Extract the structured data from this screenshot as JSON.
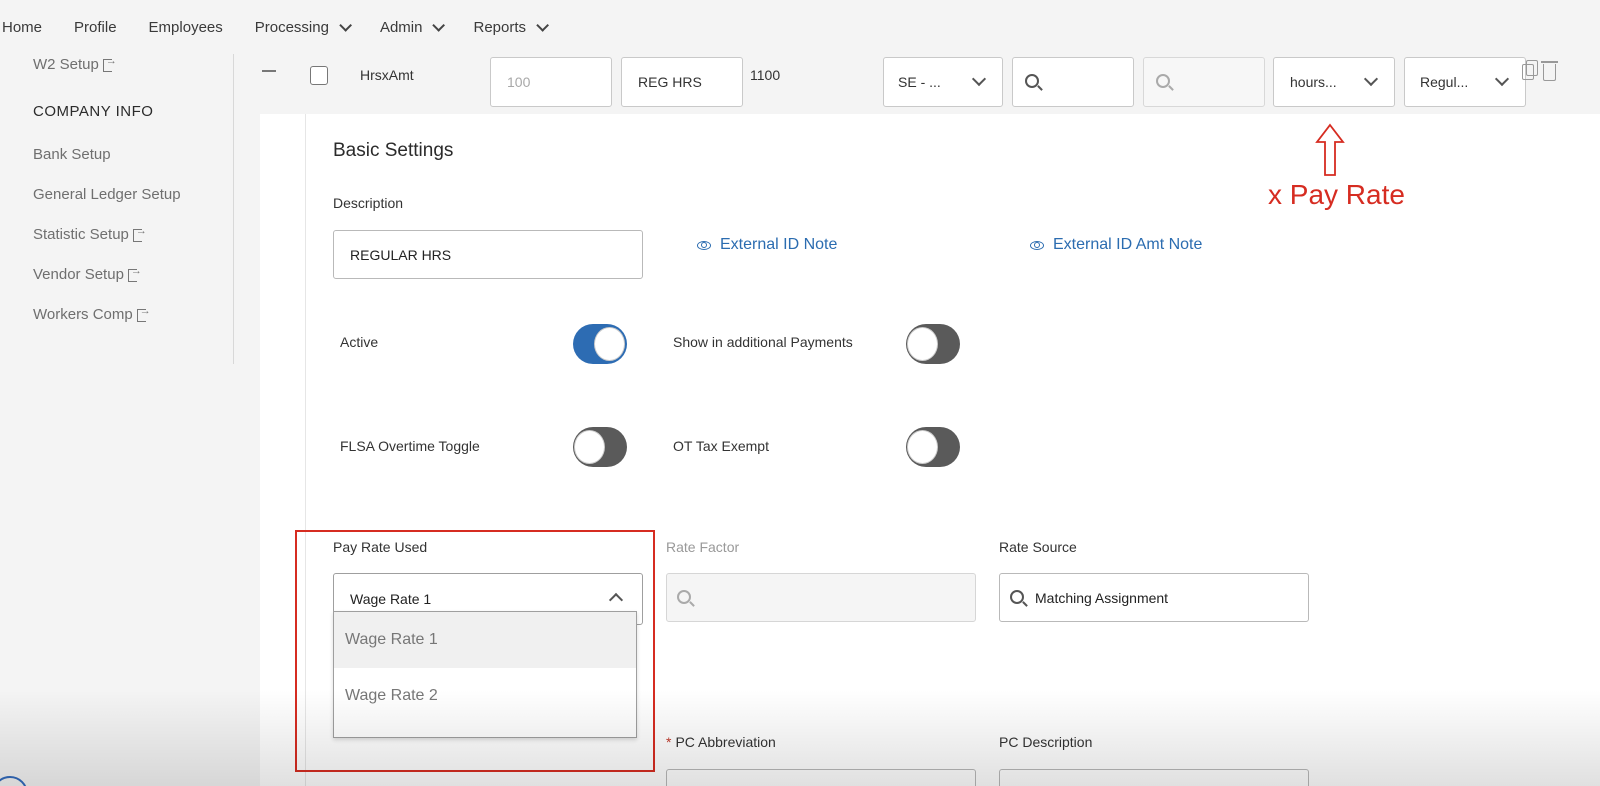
{
  "nav": {
    "items": [
      {
        "label": "Home",
        "dropdown": false
      },
      {
        "label": "Profile",
        "dropdown": false
      },
      {
        "label": "Employees",
        "dropdown": false
      },
      {
        "label": "Processing",
        "dropdown": true
      },
      {
        "label": "Admin",
        "dropdown": true
      },
      {
        "label": "Reports",
        "dropdown": true
      }
    ]
  },
  "sidebar": {
    "w2_setup": "W2 Setup",
    "section_title": "COMPANY INFO",
    "items": [
      {
        "label": "Bank Setup",
        "external": false
      },
      {
        "label": "General Ledger Setup",
        "external": false
      },
      {
        "label": "Statistic Setup",
        "external": true
      },
      {
        "label": "Vendor Setup",
        "external": true
      },
      {
        "label": "Workers Comp",
        "external": true
      }
    ]
  },
  "code_row": {
    "code": "HrsxAmt",
    "amount_placeholder": "100",
    "abbreviation": "REG HRS",
    "number": "1100",
    "select_1": "SE - ...",
    "select_hours": "hours...",
    "select_regular": "Regul..."
  },
  "basic_settings": {
    "title": "Basic Settings",
    "description_label": "Description",
    "description_value": "REGULAR HRS",
    "external_id_note": "External ID Note",
    "external_id_amt_note": "External ID Amt Note",
    "toggles": {
      "active": {
        "label": "Active",
        "on": true
      },
      "show_additional": {
        "label": "Show in additional Payments",
        "on": false
      },
      "flsa": {
        "label": "FLSA Overtime Toggle",
        "on": false
      },
      "ot_tax_exempt": {
        "label": "OT Tax Exempt",
        "on": false
      }
    },
    "pay_rate_used_label": "Pay Rate Used",
    "pay_rate_used_value": "Wage Rate 1",
    "pay_rate_options": [
      "Wage Rate 1",
      "Wage Rate 2"
    ],
    "rate_factor_label": "Rate Factor",
    "rate_source_label": "Rate Source",
    "rate_source_value": "Matching Assignment",
    "pc_abbreviation_label": "PC Abbreviation",
    "pc_description_label": "PC Description"
  },
  "annotation": {
    "text": "x Pay Rate",
    "color": "#d62c21"
  },
  "colors": {
    "accent_blue": "#2d6cb3",
    "link_blue": "#2b6cb0",
    "annotation_red": "#d62c21"
  }
}
